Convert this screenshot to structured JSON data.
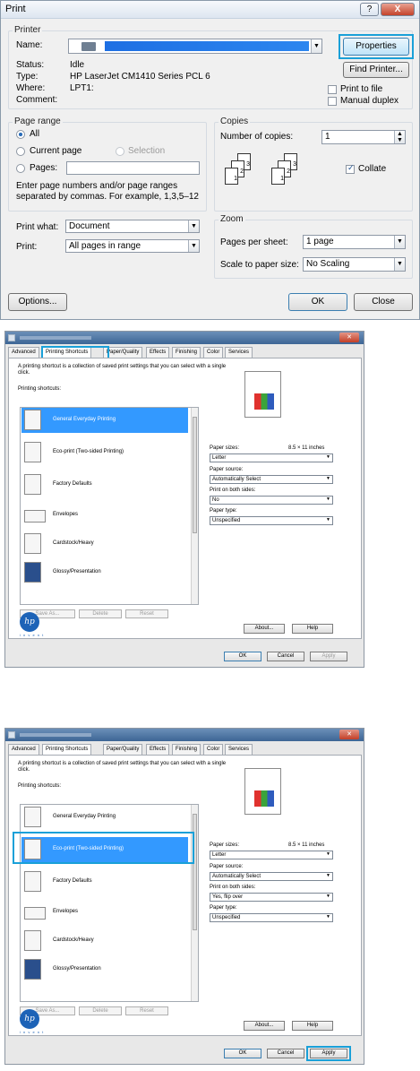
{
  "print_dialog": {
    "title": "Print",
    "help_button": "?",
    "close_button": "X",
    "printer_group": "Printer",
    "name_label": "Name:",
    "properties_button": "Properties",
    "find_printer_button": "Find Printer...",
    "status_label": "Status:",
    "status_value": "Idle",
    "type_label": "Type:",
    "type_value": "HP LaserJet CM1410 Series PCL 6",
    "where_label": "Where:",
    "where_value": "LPT1:",
    "comment_label": "Comment:",
    "print_to_file": "Print to file",
    "manual_duplex": "Manual duplex",
    "page_range_group": "Page range",
    "all_option": "All",
    "current_page_option": "Current page",
    "selection_option": "Selection",
    "pages_option": "Pages:",
    "range_hint": "Enter page numbers and/or page ranges separated by commas.  For example, 1,3,5–12",
    "copies_group": "Copies",
    "number_of_copies_label": "Number of copies:",
    "copies_value": "1",
    "collate_label": "Collate",
    "print_what_label": "Print what:",
    "print_what_value": "Document",
    "print_label": "Print:",
    "print_value": "All pages in range",
    "zoom_group": "Zoom",
    "pages_per_sheet_label": "Pages per sheet:",
    "pages_per_sheet_value": "1 page",
    "scale_label": "Scale to paper size:",
    "scale_value": "No Scaling",
    "options_button": "Options...",
    "ok_button": "OK",
    "close_dialog_button": "Close",
    "collate_pages": [
      "3",
      "2",
      "1",
      "3",
      "2",
      "1"
    ]
  },
  "driver_dialogs": [
    {
      "tabs": [
        "Advanced",
        "Printing Shortcuts",
        "Paper/Quality",
        "Effects",
        "Finishing",
        "Color",
        "Services"
      ],
      "description": "A printing shortcut is a collection of saved print settings that you can select with a single click.",
      "shortcuts_label": "Printing shortcuts:",
      "shortcuts": [
        "General Everyday Printing",
        "Eco-print (Two-sided Printing)",
        "Factory Defaults",
        "Envelopes",
        "Cardstock/Heavy",
        "Glossy/Presentation"
      ],
      "selected_index": 0,
      "save_as": "Save As...",
      "delete": "Delete",
      "reset": "Reset",
      "paper_sizes_label": "Paper sizes:",
      "paper_sizes_dim": "8.5 × 11 inches",
      "paper_sizes_value": "Letter",
      "paper_source_label": "Paper source:",
      "paper_source_value": "Automatically Select",
      "both_sides_label": "Print on both sides:",
      "both_sides_value": "No",
      "paper_type_label": "Paper type:",
      "paper_type_value": "Unspecified",
      "about": "About...",
      "help": "Help",
      "ok": "OK",
      "cancel": "Cancel",
      "apply": "Apply",
      "hp_logo": "hp",
      "invent": "i n v e n t"
    },
    {
      "tabs": [
        "Advanced",
        "Printing Shortcuts",
        "Paper/Quality",
        "Effects",
        "Finishing",
        "Color",
        "Services"
      ],
      "description": "A printing shortcut is a collection of saved print settings that you can select with a single click.",
      "shortcuts_label": "Printing shortcuts:",
      "shortcuts": [
        "General Everyday Printing",
        "Eco-print (Two-sided Printing)",
        "Factory Defaults",
        "Envelopes",
        "Cardstock/Heavy",
        "Glossy/Presentation"
      ],
      "selected_index": 1,
      "save_as": "Save As...",
      "delete": "Delete",
      "reset": "Reset",
      "paper_sizes_label": "Paper sizes:",
      "paper_sizes_dim": "8.5 × 11 inches",
      "paper_sizes_value": "Letter",
      "paper_source_label": "Paper source:",
      "paper_source_value": "Automatically Select",
      "both_sides_label": "Print on both sides:",
      "both_sides_value": "Yes, flip over",
      "paper_type_label": "Paper type:",
      "paper_type_value": "Unspecified",
      "about": "About...",
      "help": "Help",
      "ok": "OK",
      "cancel": "Cancel",
      "apply": "Apply",
      "hp_logo": "hp",
      "invent": "i n v e n t"
    }
  ],
  "colors": {
    "highlight": "#1aa0d8",
    "selection": "#3399ff",
    "hp_blue": "#1d63b7"
  }
}
